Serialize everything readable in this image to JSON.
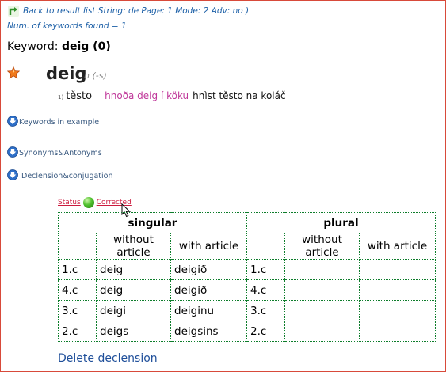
{
  "nav": {
    "back_label": "Back to result list String: de Page: 1 Mode: 2 Adv: no )",
    "found_text": "Num. of keywords found = 1"
  },
  "keyword": {
    "label": "Keyword: ",
    "value": "deig (0)"
  },
  "entry": {
    "headword": "deig",
    "grammar": "n (-s)",
    "sense_number": "1)",
    "translation": "těsto",
    "example_source": "hnoða deig í köku",
    "example_target": "hnìst těsto na koláč"
  },
  "sections": {
    "keywords_in_example": "Keywords in example",
    "synonyms": "Synonyms&Antonyms",
    "declension": " Declension&conjugation"
  },
  "status": {
    "label": "Status",
    "value": "Corrected"
  },
  "declension_table": {
    "singular_label": "singular",
    "plural_label": "plural",
    "without_article": "without article",
    "with_article": "with article",
    "rows": [
      {
        "case": "1.c",
        "sg_without": "deig",
        "sg_with": "deigið",
        "pl_case": "1.c",
        "pl_without": "",
        "pl_with": ""
      },
      {
        "case": "4.c",
        "sg_without": "deig",
        "sg_with": "deigið",
        "pl_case": "4.c",
        "pl_without": "",
        "pl_with": ""
      },
      {
        "case": "3.c",
        "sg_without": "deigi",
        "sg_with": "deiginu",
        "pl_case": "3.c",
        "pl_without": "",
        "pl_with": ""
      },
      {
        "case": "2.c",
        "sg_without": "deigs",
        "sg_with": "deigsins",
        "pl_case": "2.c",
        "pl_without": "",
        "pl_with": ""
      }
    ]
  },
  "actions": {
    "delete_label": "Delete declension"
  },
  "colors": {
    "frame_border": "#d84a3a",
    "link_blue": "#1a5ea6",
    "example_pink": "#c0389a",
    "status_red": "#cc1b3e",
    "table_border": "#0d7d2b"
  },
  "icons": {
    "back": "return-arrow-icon",
    "favorite": "star-icon",
    "expand": "blue-down-arrow-icon",
    "status": "green-ball-icon",
    "pointer": "mouse-cursor-icon"
  }
}
